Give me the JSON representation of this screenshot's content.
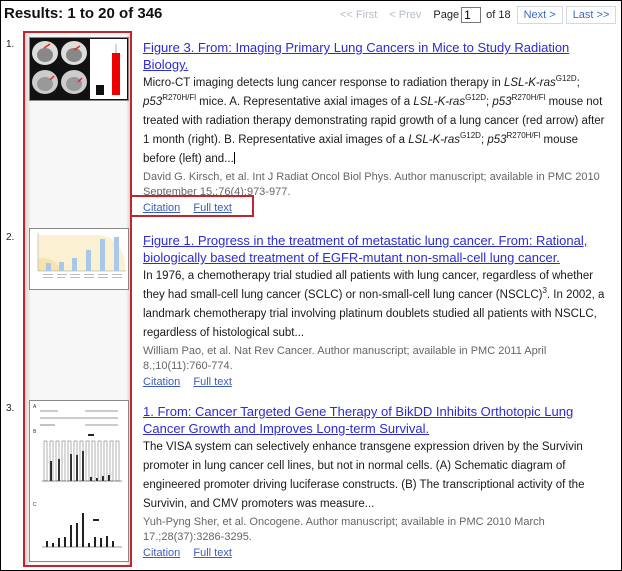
{
  "header": {
    "results_label": "Results: 1 to 20 of 346"
  },
  "pager": {
    "first": "<< First",
    "prev": "< Prev",
    "page_label": "Page",
    "page_value": "1",
    "of_label": "of 18",
    "next": "Next >",
    "last": "Last >>"
  },
  "results": [
    {
      "number": "1.",
      "thumbnail_icon": "figure-thumbnail-ct-scans",
      "title": "Figure 3. From: Imaging Primary Lung Cancers in Mice to Study Radiation Biology.",
      "snippet": {
        "p1": "Micro-CT imaging detects lung cancer response to radiation therapy in ",
        "i1": "LSL-K-ras",
        "s1": "G12D",
        "p2": "; ",
        "i2": "p53",
        "s2": "R270H/Fl",
        "p3": " mice. A. Representative axial images of a ",
        "i3": "LSL-K-ras",
        "s3": "G12D",
        "p4": "; ",
        "i4": "p53",
        "s4": "R270H/Fl",
        "p5": " mouse not treated with radiation therapy demonstrating rapid growth of a lung cancer (red arrow) after 1 month (right). B. Representative axial images of a ",
        "i5": "LSL-K-ras",
        "s5": "G12D",
        "p6": "; ",
        "i6": "p53",
        "s6": "R270H/Fl",
        "p7": " mouse before (left) and..."
      },
      "citation": "David G. Kirsch, et al. Int J Radiat Oncol Biol Phys. Author manuscript; available in PMC 2010 September 15.;76(4):973-977.",
      "links": [
        "Citation",
        "Full text"
      ]
    },
    {
      "number": "2.",
      "thumbnail_icon": "figure-thumbnail-bar-chart",
      "title": "Figure 1. Progress in the treatment of metastatic lung cancer. From: Rational, biologically based treatment of EGFR-mutant non-small-cell lung cancer.",
      "snippet": {
        "p1": "In 1976, a chemotherapy trial studied all patients with lung cancer, regardless of whether they had small-cell lung cancer (SCLC) or non-small-cell lung cancer (NSCLC)",
        "s1": "3",
        "p2": ". In 2002, a landmark chemotherapy trial involving platinum doublets studied all patients with NSCLC, regardless of histological subt..."
      },
      "citation": "William Pao, et al. Nat Rev Cancer. Author manuscript; available in PMC 2011 April 8.;10(11):760-774.",
      "links": [
        "Citation",
        "Full text"
      ]
    },
    {
      "number": "3.",
      "thumbnail_icon": "figure-thumbnail-multi-panel",
      "title": "1. From: Cancer Targeted Gene Therapy of BikDD Inhibits Orthotopic Lung Cancer Growth and Improves Long-term Survival.",
      "snippet": {
        "p1": "The VISA system can selectively enhance transgene expression driven by the Survivin promoter in lung cancer cell lines, but not in normal cells. (A) Schematic diagram of engineered promoter driving luciferase constructs. (B) The transcriptional activity of the Survivin, and CMV promoters was measure..."
      },
      "citation": "Yuh-Pyng Sher, et al. Oncogene. Author manuscript; available in PMC 2010 March 17.;28(37):3286-3295.",
      "links": [
        "Citation",
        "Full text"
      ]
    }
  ],
  "colors": {
    "highlight_border": "#c0262c",
    "link": "#2b2bd8",
    "secondary_link": "#3b5cc0",
    "citation_text": "#666666"
  }
}
